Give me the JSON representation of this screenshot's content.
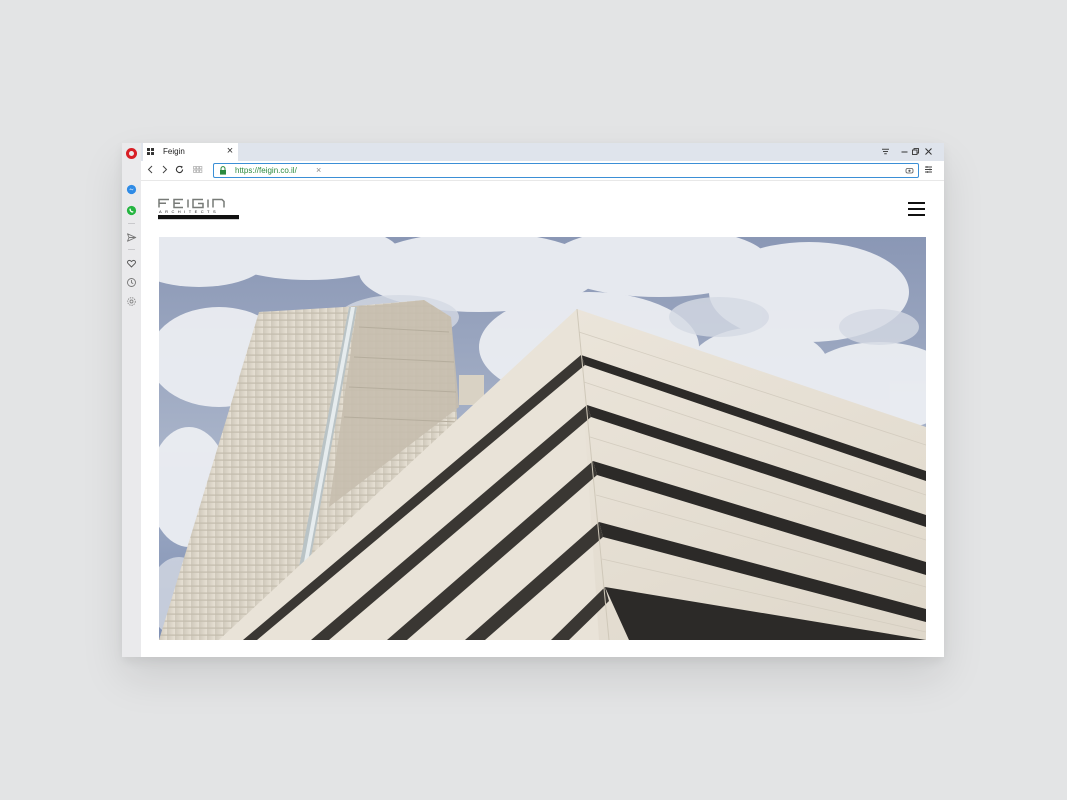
{
  "browser": {
    "tab": {
      "title": "Feigin"
    },
    "address_bar": {
      "url": "https://feigin.co.il/"
    }
  },
  "sidebar": {
    "icons": [
      "vivaldi-logo-icon",
      "messenger-icon",
      "whatsapp-icon",
      "send-icon",
      "heart-icon",
      "history-icon",
      "settings-icon"
    ]
  },
  "site": {
    "logo_text": "FEIGIN",
    "logo_subtext": "ARCHITECTS",
    "menu_icon": "hamburger-menu-icon",
    "hero": {
      "description_icon": "building-photo"
    }
  },
  "colors": {
    "url_text": "#2b8a3e",
    "url_focus": "#3b8fd6",
    "sidebar_logo": "#d81f26",
    "logo_gray": "#777a77"
  }
}
